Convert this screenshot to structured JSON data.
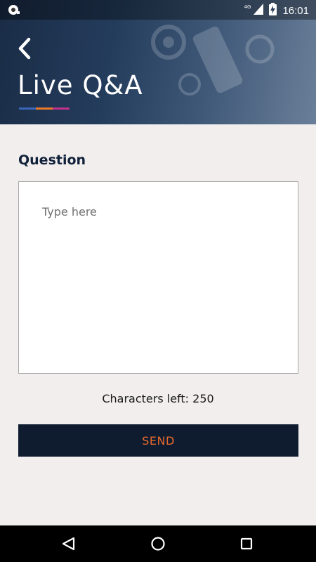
{
  "status_bar": {
    "network": "4G",
    "time": "16:01",
    "icons": [
      "notification-icon",
      "signal-icon",
      "battery-charging-icon"
    ]
  },
  "header": {
    "title": "Live Q&A",
    "back_icon": "chevron-left-icon",
    "accent_colors": [
      "#3b66b8",
      "#e97a2a",
      "#c2328e"
    ]
  },
  "form": {
    "label": "Question",
    "placeholder": "Type here",
    "value": "",
    "chars_left": "Characters left: 250",
    "send_label": "SEND"
  },
  "colors": {
    "send_bg": "#0f1c30",
    "send_text": "#e9692c",
    "background": "#f1eeed"
  },
  "nav_bar": {
    "icons": [
      "back-triangle-icon",
      "home-circle-icon",
      "recents-square-icon"
    ]
  }
}
